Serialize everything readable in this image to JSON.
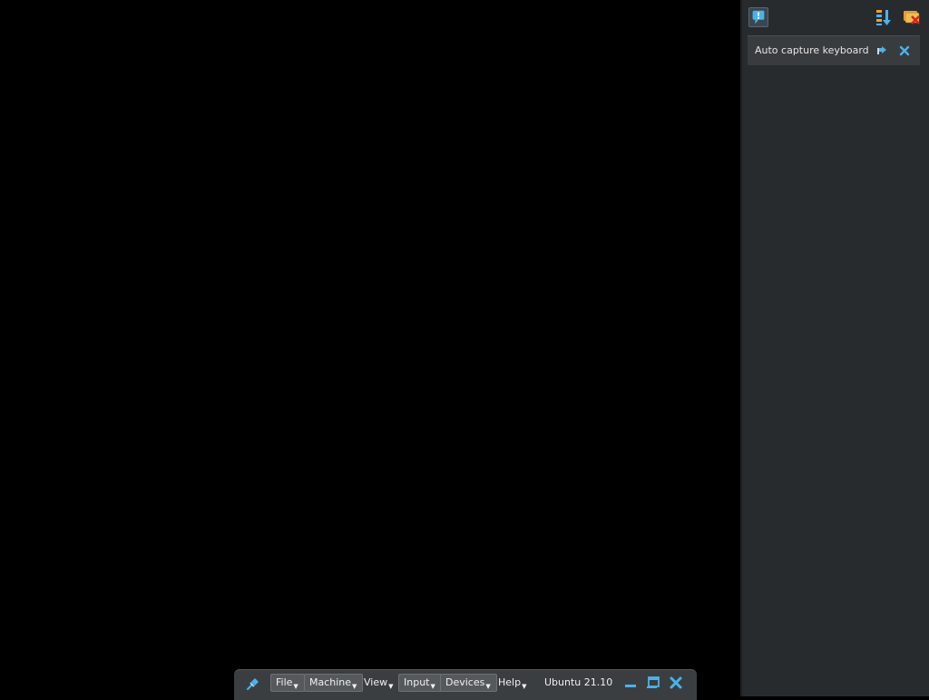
{
  "colors": {
    "screen_bg": "#000000",
    "panel_bg": "#282b2d",
    "notification_bg": "#393c3f",
    "toolbar_bg": "#3b3e41",
    "icon_accent": "#4ab3ea"
  },
  "notification_center": {
    "header": {
      "toggle_icon": "notification-bubble-icon",
      "sort_icon": "sort-order-icon",
      "clear_icon": "clear-all-icon"
    },
    "items": [
      {
        "text": "Auto capture keyboard ...",
        "pin_icon": "pin-icon",
        "close_icon": "close-icon"
      }
    ]
  },
  "mini_toolbar": {
    "pin_icon": "pin-icon",
    "menus": [
      {
        "label": "File",
        "framed": true
      },
      {
        "label": "Machine",
        "framed": true
      },
      {
        "label": "View",
        "framed": false
      },
      {
        "label": "Input",
        "framed": true
      },
      {
        "label": "Devices",
        "framed": true
      },
      {
        "label": "Help",
        "framed": false
      }
    ],
    "vm_name": "Ubuntu 21.10",
    "window_buttons": [
      "minimize-icon",
      "restore-icon",
      "close-icon"
    ]
  }
}
